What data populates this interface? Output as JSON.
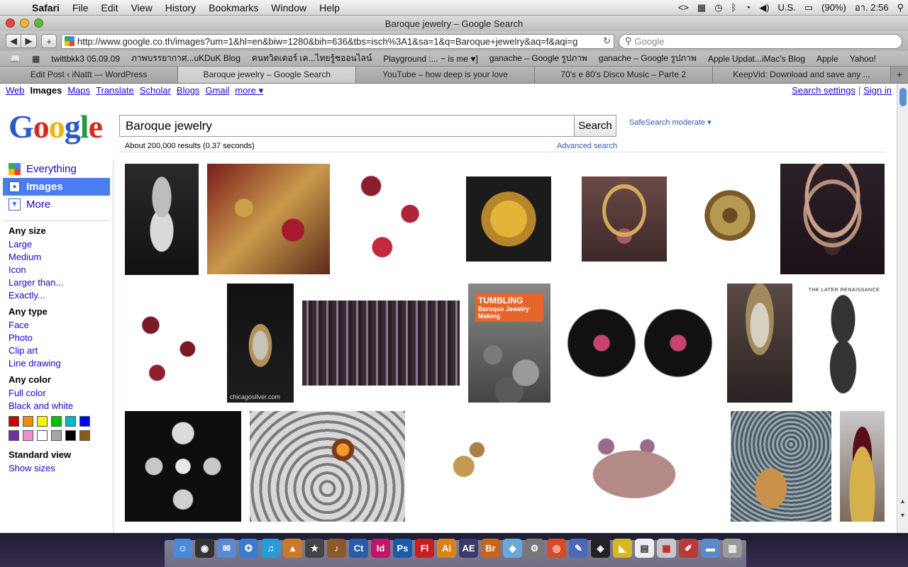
{
  "menubar": {
    "app": "Safari",
    "items": [
      "File",
      "Edit",
      "View",
      "History",
      "Bookmarks",
      "Window",
      "Help"
    ],
    "status": {
      "input_source": "U.S.",
      "battery": "(90%)",
      "clock": "อา. 2:56"
    }
  },
  "window": {
    "title": "Baroque jewelry – Google Search"
  },
  "toolbar": {
    "url": "http://www.google.co.th/images?um=1&hl=en&biw=1280&bih=636&tbs=isch%3A1&sa=1&q=Baroque+jewelry&aq=f&aqi=g",
    "search_placeholder": "Google"
  },
  "bookmarks": [
    "twittbkk3 05.09.09",
    "ภาพบรรยากาศ...uKDuK Blog",
    "คนทวิตเตอร์ เค...ไทยรู้ชออนไลน์",
    "Playground :... ~ is me ♥]",
    "ganache – Google รูปภาพ",
    "ganache – Google รูปภาพ",
    "Apple Updat...iMac's Blog",
    "Apple",
    "Yahoo!"
  ],
  "tabs": [
    {
      "label": "Edit Post ‹ iNattt — WordPress",
      "active": false
    },
    {
      "label": "Baroque jewelry – Google Search",
      "active": true
    },
    {
      "label": "YouTube – how deep is your love",
      "active": false
    },
    {
      "label": "70's e 80's Disco Music – Parte 2",
      "active": false
    },
    {
      "label": "KeepVid: Download and save any ...",
      "active": false
    }
  ],
  "google": {
    "topnav": {
      "web": "Web",
      "images": "Images",
      "maps": "Maps",
      "translate": "Translate",
      "scholar": "Scholar",
      "blogs": "Blogs",
      "gmail": "Gmail",
      "more": "more ▾"
    },
    "topright": {
      "settings": "Search settings",
      "sep": "|",
      "signin": "Sign in"
    },
    "logo": {
      "g1": "G",
      "o1": "o",
      "o2": "o",
      "g2": "g",
      "l": "l",
      "e": "e"
    },
    "query": "Baroque jewelry",
    "search_button": "Search",
    "safesearch": "SafeSearch moderate ▾",
    "stats": "About 200,000 results (0.37 seconds)",
    "advanced": "Advanced search"
  },
  "sidebar": {
    "modes": {
      "everything": "Everything",
      "images": "Images",
      "more": "More"
    },
    "size": {
      "heading": "Any size",
      "large": "Large",
      "medium": "Medium",
      "icon": "Icon",
      "larger": "Larger than...",
      "exactly": "Exactly..."
    },
    "type": {
      "heading": "Any type",
      "face": "Face",
      "photo": "Photo",
      "clipart": "Clip art",
      "linedrawing": "Line drawing"
    },
    "color": {
      "heading": "Any color",
      "full": "Full color",
      "bw": "Black and white"
    },
    "swatches": [
      "#cc0000",
      "#f08c00",
      "#f5f500",
      "#00c000",
      "#00b5c8",
      "#0000ff",
      "#7030a0",
      "#ee8ed6",
      "#ffffff",
      "#a6a6a6",
      "#000000",
      "#8a5a1c"
    ],
    "view": {
      "heading": "Standard view",
      "show_sizes": "Show sizes"
    }
  },
  "images": {
    "tumbling_title": "TUMBLING",
    "tumbling_sub": "Baroque Jewelry Making",
    "later_title": "THE LATER RENAISSANCE",
    "chicago_caption": "chicagosilver.com"
  },
  "colors": {
    "accent": "#4a7ded",
    "link": "#2200cc"
  }
}
